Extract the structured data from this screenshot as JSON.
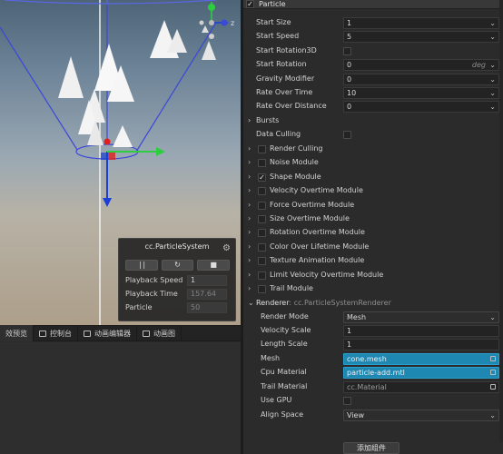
{
  "scene": {
    "gizmo_axis_label": "z",
    "panel": {
      "title": "cc.ParticleSystem",
      "play_pause": " | |",
      "restart": "↻",
      "stop": "■",
      "rows": [
        {
          "label": "Playback Speed",
          "value": "1"
        },
        {
          "label": "Playback Time",
          "value": "157.64"
        },
        {
          "label": "Particle",
          "value": "50"
        }
      ]
    }
  },
  "dock": {
    "tabs": [
      {
        "label": "效预览"
      },
      {
        "label": "控制台"
      },
      {
        "label": "动画编辑器"
      },
      {
        "label": "动画图"
      }
    ]
  },
  "inspector": {
    "component_title": "Particle",
    "props": [
      {
        "label": "Start Size",
        "value": "1"
      },
      {
        "label": "Start Speed",
        "value": "5"
      },
      {
        "label": "Start Rotation3D",
        "value": ""
      },
      {
        "label": "Start Rotation",
        "value": "0",
        "unit": "deg"
      },
      {
        "label": "Gravity Modifier",
        "value": "0"
      },
      {
        "label": "Rate Over Time",
        "value": "10"
      },
      {
        "label": "Rate Over Distance",
        "value": "0"
      }
    ],
    "bursts_label": "Bursts",
    "data_culling_label": "Data Culling",
    "modules": [
      {
        "label": "Render Culling",
        "checked": false
      },
      {
        "label": "Noise Module",
        "checked": false
      },
      {
        "label": "Shape Module",
        "checked": true
      },
      {
        "label": "Velocity Overtime Module",
        "checked": false
      },
      {
        "label": "Force Overtime Module",
        "checked": false
      },
      {
        "label": "Size Overtime Module",
        "checked": false
      },
      {
        "label": "Rotation Overtime Module",
        "checked": false
      },
      {
        "label": "Color Over Lifetime Module",
        "checked": false
      },
      {
        "label": "Texture Animation Module",
        "checked": false
      },
      {
        "label": "Limit Velocity Overtime Module",
        "checked": false
      },
      {
        "label": "Trail Module",
        "checked": false
      }
    ],
    "renderer": {
      "title": "Renderer",
      "subtitle": ": cc.ParticleSystemRenderer",
      "render_mode_label": "Render Mode",
      "render_mode": "Mesh",
      "velocity_scale_label": "Velocity Scale",
      "velocity_scale": "1",
      "length_scale_label": "Length Scale",
      "length_scale": "1",
      "mesh_label": "Mesh",
      "mesh": "cone.mesh",
      "cpu_material_label": "Cpu Material",
      "cpu_material": "particle-add.mtl",
      "trail_material_label": "Trail Material",
      "trail_material": "cc.Material",
      "use_gpu_label": "Use GPU",
      "align_space_label": "Align Space",
      "align_space": "View"
    },
    "add_component": "添加组件",
    "colors": {
      "asset_field": "#1e88b3",
      "gizmo_x": "#2ecc40",
      "gizmo_y": "#1a3fd6",
      "gizmo_z": "#e02020"
    }
  }
}
